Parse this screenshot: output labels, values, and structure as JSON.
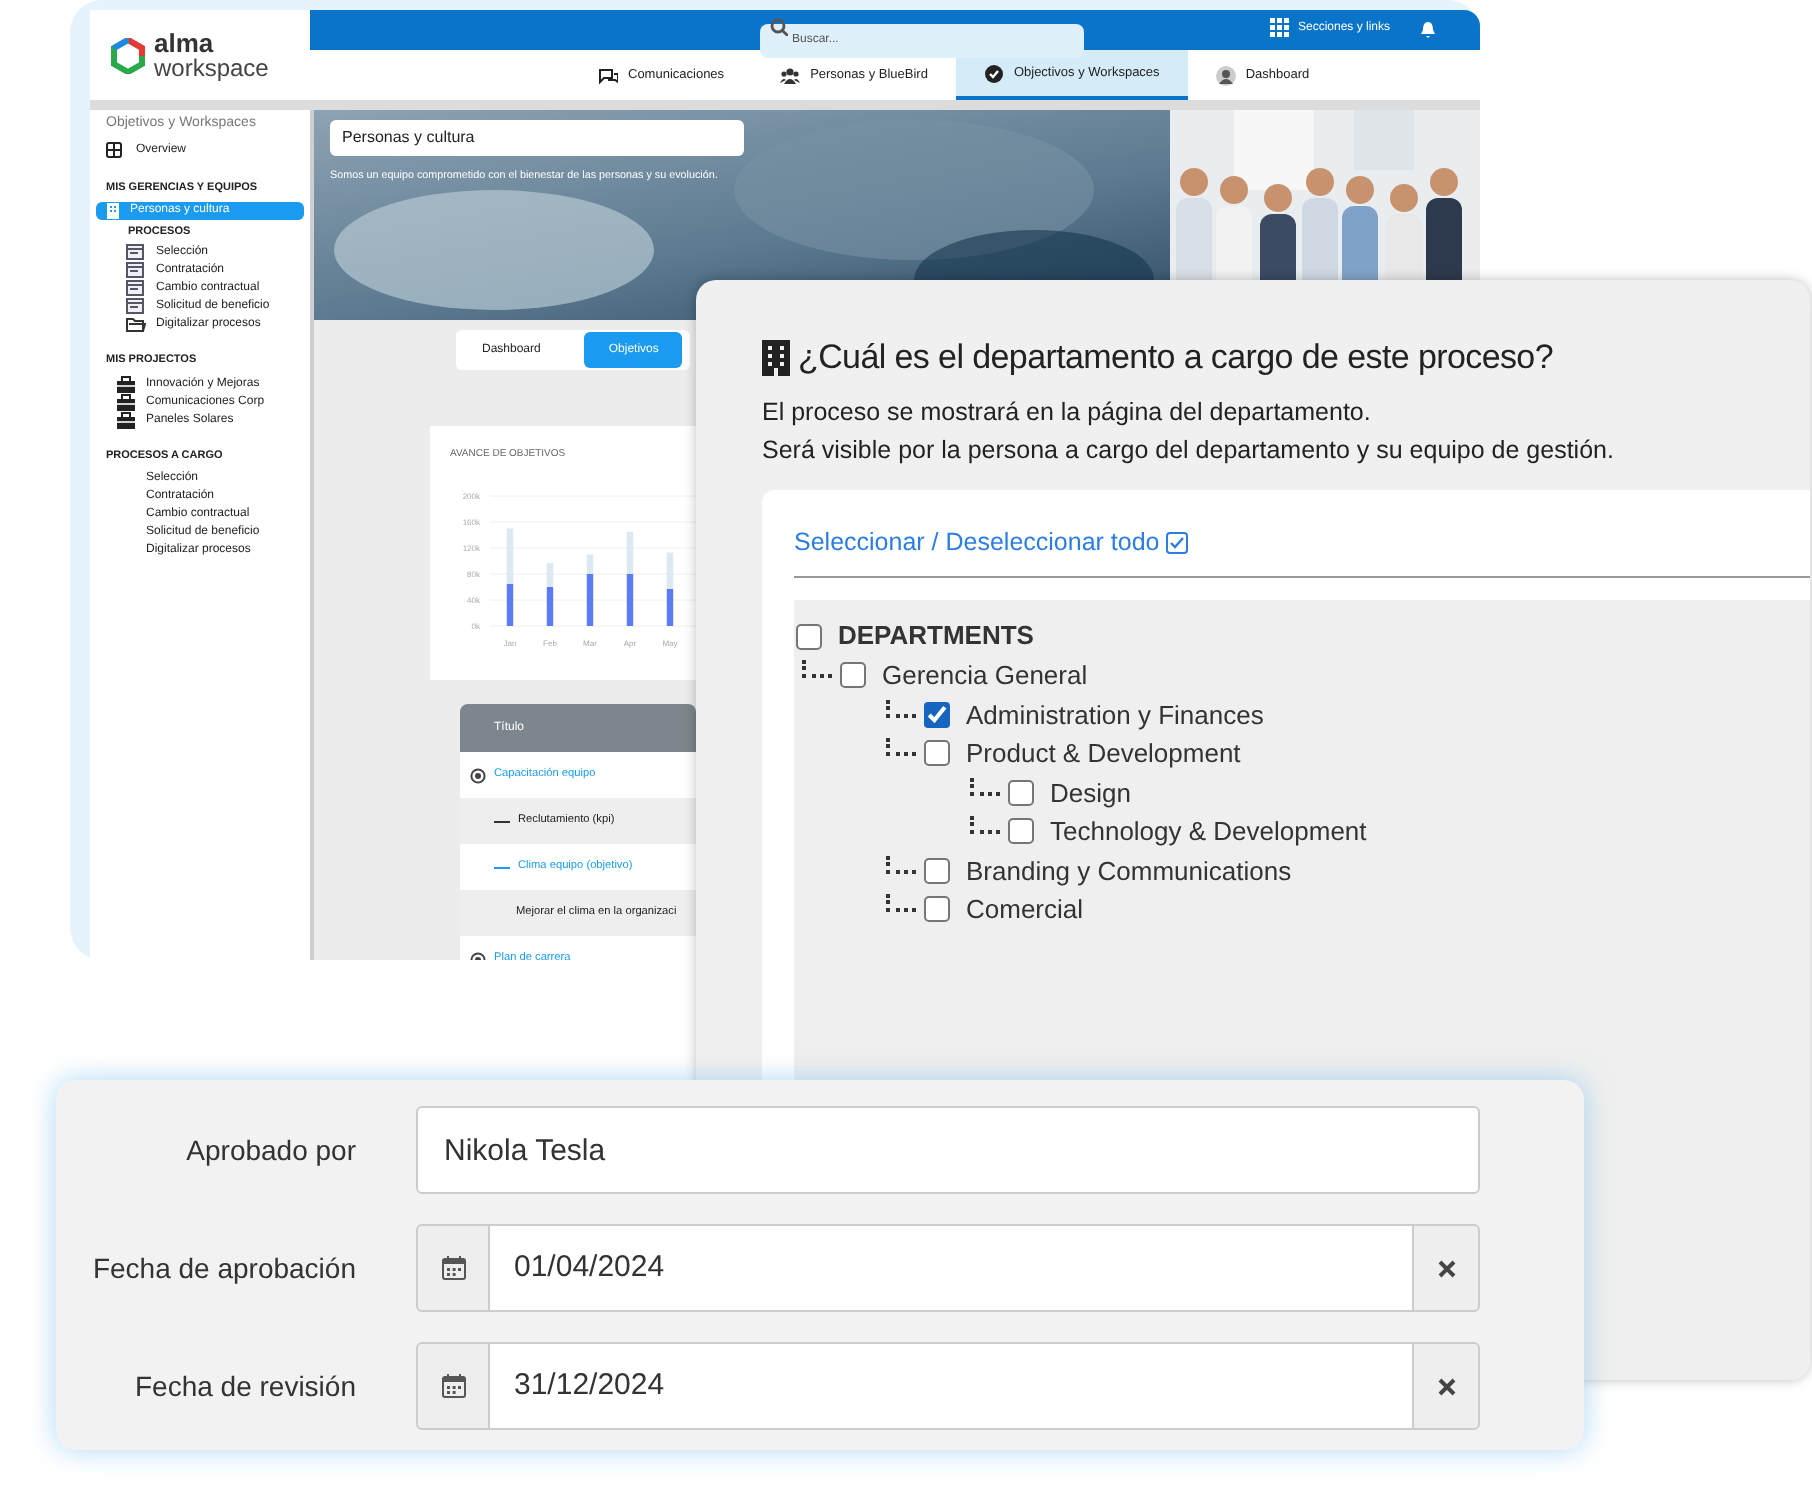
{
  "app": {
    "logo": {
      "name": "alma",
      "sub": "workspace"
    },
    "search": {
      "placeholder": "Buscar..."
    },
    "sections_link": "Secciones y links",
    "tabs": [
      {
        "label": "Comunicaciones",
        "kind": "chat",
        "selected": false
      },
      {
        "label": "Personas y BlueBird",
        "kind": "people",
        "selected": false
      },
      {
        "label": "Objectivos y Workspaces",
        "kind": "check",
        "selected": true
      },
      {
        "label": "Dashboard",
        "kind": "avatar",
        "selected": false
      }
    ],
    "sidebar": {
      "title": "Objetivos y Workspaces",
      "sections": [
        {
          "items": [
            {
              "label": "Overview",
              "kind": "grid",
              "selected": false
            }
          ]
        },
        {
          "heading": "MIS GERENCIAS Y EQUIPOS",
          "items": [
            {
              "label": "Personas y cultura",
              "kind": "team",
              "selected": true
            },
            {
              "label": "PROCESOS",
              "kind": "subheading"
            },
            {
              "label": "Selección",
              "kind": "process",
              "selected": false
            },
            {
              "label": "Contratación",
              "kind": "process",
              "selected": false
            },
            {
              "label": "Cambio contractual",
              "kind": "process",
              "selected": false
            },
            {
              "label": "Solicitud de beneficio",
              "kind": "process",
              "selected": false
            },
            {
              "label": "Digitalizar procesos",
              "kind": "folder",
              "selected": false
            }
          ]
        },
        {
          "heading": "MIS PROJECTOS",
          "items": [
            {
              "label": "Innovación y Mejoras",
              "kind": "project",
              "selected": false
            },
            {
              "label": "Comunicaciones Corp",
              "kind": "project",
              "selected": false
            },
            {
              "label": "Paneles Solares",
              "kind": "project",
              "selected": false
            }
          ]
        },
        {
          "heading": "PROCESOS A CARGO",
          "items": [
            {
              "label": "Selección",
              "kind": "plain",
              "selected": false
            },
            {
              "label": "Contratación",
              "kind": "plain",
              "selected": false
            },
            {
              "label": "Cambio contractual",
              "kind": "plain",
              "selected": false
            },
            {
              "label": "Solicitud de beneficio",
              "kind": "plain",
              "selected": false
            },
            {
              "label": "Digitalizar procesos",
              "kind": "plain",
              "selected": false
            }
          ]
        }
      ]
    },
    "hero": {
      "title": "Personas y cultura",
      "subtitle": "Somos un equipo comprometido con el bienestar de las personas y su evolución."
    },
    "view_toggle": [
      {
        "label": "Dashboard",
        "selected": false
      },
      {
        "label": "Objetivos",
        "selected": true
      }
    ],
    "chart": {
      "chart_data": {
        "type": "bar",
        "title": "AVANCE DE OBJETIVOS",
        "categories": [
          "Jan",
          "Feb",
          "Mar",
          "Apr",
          "May"
        ],
        "series": [
          {
            "color": "#5b7bf5",
            "values": [
              65,
              60,
              80,
              80,
              57
            ]
          },
          {
            "color": "#dde9f1",
            "values": [
              85,
              37,
              30,
              65,
              56
            ]
          }
        ],
        "stacked": true,
        "grid": true,
        "ylim": [
          0,
          200
        ],
        "yticks": [
          {
            "value": 0,
            "label": "0k"
          },
          {
            "value": 40,
            "label": "40k"
          },
          {
            "value": 80,
            "label": "80k"
          },
          {
            "value": 120,
            "label": "120k"
          },
          {
            "value": 160,
            "label": "160k"
          },
          {
            "value": 200,
            "label": "200k"
          }
        ]
      }
    },
    "table": {
      "columns": [
        "Título"
      ],
      "rows": [
        {
          "kind": "goal",
          "text": "Capacitación equipo"
        },
        {
          "kind": "kpi",
          "text": "Reclutamiento  (kpi)"
        },
        {
          "kind": "objective",
          "text": "Clima equipo (objetivo)"
        },
        {
          "kind": "note",
          "text": "Mejorar el clima en la organizaci"
        },
        {
          "kind": "goal",
          "text": "Plan de carrera"
        }
      ]
    }
  },
  "department_panel": {
    "title": "¿Cuál es el departamento a cargo de este proceso?",
    "description": [
      "El proceso se mostrará en la página del departamento.",
      "Será visible por la persona a cargo del departamento y su equipo de gestión."
    ],
    "select_all": "Seleccionar / Deseleccionar todo",
    "tree": [
      {
        "label": "DEPARTMENTS",
        "checked": false,
        "children": [
          {
            "label": "Gerencia General",
            "checked": false,
            "children": [
              {
                "label": "Administration y Finances",
                "checked": true
              },
              {
                "label": "Product & Development",
                "checked": false,
                "children": [
                  {
                    "label": "Design",
                    "checked": false
                  },
                  {
                    "label": "Technology & Development",
                    "checked": false
                  }
                ]
              },
              {
                "label": "Branding y Communications",
                "checked": false
              },
              {
                "label": "Comercial",
                "checked": false
              }
            ]
          }
        ]
      }
    ]
  },
  "approval_form": [
    {
      "label": "Aprobado por",
      "kind": "text",
      "value": "Nikola Tesla"
    },
    {
      "label": "Fecha de aprobación",
      "kind": "date",
      "value": "01/04/2024"
    },
    {
      "label": "Fecha de revisión",
      "kind": "date",
      "value": "31/12/2024"
    }
  ]
}
